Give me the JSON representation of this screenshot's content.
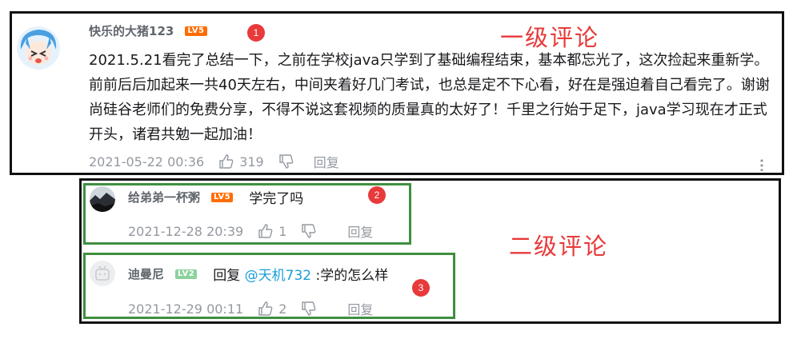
{
  "comment1": {
    "username": "快乐的大猪123",
    "level": "LV5",
    "badge": "1",
    "text": "2021.5.21看完了总结一下，之前在学校java只学到了基础编程结束，基本都忘光了，这次捡起来重新学。前前后后加起来一共40天左右，中间夹着好几门考试，也总是定不下心看，好在是强迫着自己看完了。谢谢尚硅谷老师们的免费分享，不得不说这套视频的质量真的太好了！千里之行始于足下，java学习现在才正式开头，诸君共勉一起加油！",
    "timestamp": "2021-05-22 00:36",
    "likes": "319",
    "reply_label": "回复",
    "more_icon": "more-dots-icon"
  },
  "label_level1": "一级评论",
  "label_level2": "二级评论",
  "reply1": {
    "username": "给弟弟一杯粥",
    "level": "LV5",
    "text": "学完了吗",
    "badge": "2",
    "timestamp": "2021-12-28 20:39",
    "likes": "1",
    "reply_label": "回复"
  },
  "reply2": {
    "username": "迪曼尼",
    "level": "LV2",
    "text_prefix": "回复 ",
    "mention": "@天机732",
    "text_suffix": " :学的怎么样",
    "badge": "3",
    "timestamp": "2021-12-29 00:11",
    "likes": "2",
    "reply_label": "回复"
  },
  "colors": {
    "annotation_red": "#e83a3a",
    "box_green": "#3f8f3f",
    "box_black": "#111111",
    "mention_blue": "#1a9ed9"
  }
}
